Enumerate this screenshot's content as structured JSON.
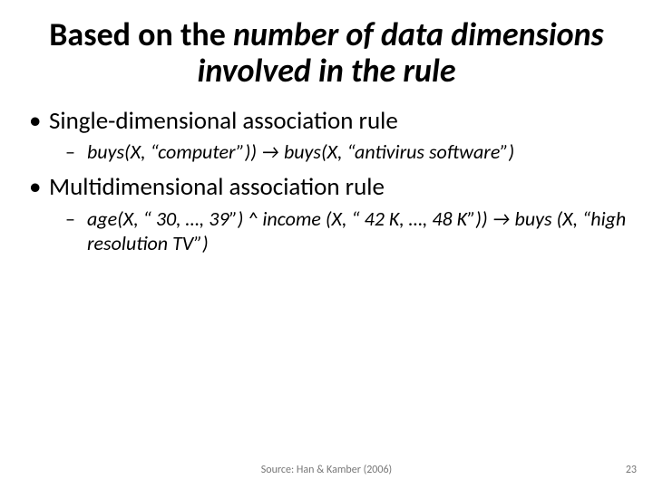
{
  "title": {
    "plain1": "Based on the ",
    "emph": "number of data dimensions involved in the rule",
    "plain2": ""
  },
  "items": [
    {
      "text": "Single-dimensional association rule",
      "sub": [
        "buys(X, “computer”)) → buys(X, “antivirus software”)"
      ]
    },
    {
      "text": "Multidimensional association rule",
      "sub": [
        "age(X, “ 30, …, 39”) ^ income (X, “ 42 K, …, 48 K”)) → buys (X, “high resolution TV”)"
      ]
    }
  ],
  "source": "Source: Han & Kamber (2006)",
  "pagenum": "23"
}
